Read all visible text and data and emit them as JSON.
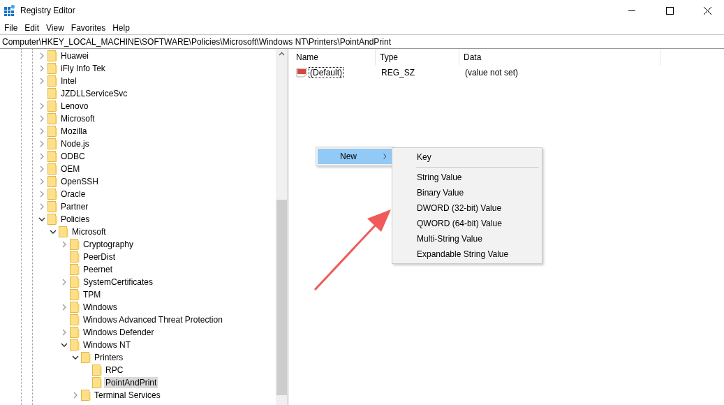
{
  "window": {
    "title": "Registry Editor"
  },
  "menu": [
    {
      "label": "File"
    },
    {
      "label": "Edit"
    },
    {
      "label": "View"
    },
    {
      "label": "Favorites"
    },
    {
      "label": "Help"
    }
  ],
  "address": "Computer\\HKEY_LOCAL_MACHINE\\SOFTWARE\\Policies\\Microsoft\\Windows NT\\Printers\\PointAndPrint",
  "tree": [
    {
      "label": "Huawei",
      "expanded": false,
      "selected": false
    },
    {
      "label": "iFly Info Tek",
      "expanded": false,
      "selected": false
    },
    {
      "label": "Intel",
      "expanded": false,
      "selected": false
    },
    {
      "label": "JZDLLServiceSvc",
      "selected": false
    },
    {
      "label": "Lenovo",
      "expanded": false,
      "selected": false
    },
    {
      "label": "Microsoft",
      "expanded": false,
      "selected": false
    },
    {
      "label": "Mozilla",
      "expanded": false,
      "selected": false
    },
    {
      "label": "Node.js",
      "expanded": false,
      "selected": false
    },
    {
      "label": "ODBC",
      "expanded": false,
      "selected": false
    },
    {
      "label": "OEM",
      "expanded": false,
      "selected": false
    },
    {
      "label": "OpenSSH",
      "expanded": false,
      "selected": false
    },
    {
      "label": "Oracle",
      "expanded": false,
      "selected": false
    },
    {
      "label": "Partner",
      "expanded": false,
      "selected": false
    },
    {
      "label": "Policies",
      "expanded": true,
      "selected": false,
      "children": [
        {
          "label": "Microsoft",
          "expanded": true,
          "selected": false,
          "children": [
            {
              "label": "Cryptography",
              "expanded": false,
              "selected": false
            },
            {
              "label": "PeerDist",
              "selected": false
            },
            {
              "label": "Peernet",
              "selected": false
            },
            {
              "label": "SystemCertificates",
              "expanded": false,
              "selected": false
            },
            {
              "label": "TPM",
              "selected": false
            },
            {
              "label": "Windows",
              "expanded": false,
              "selected": false
            },
            {
              "label": "Windows Advanced Threat Protection",
              "selected": false
            },
            {
              "label": "Windows Defender",
              "expanded": false,
              "selected": false
            },
            {
              "label": "Windows NT",
              "expanded": true,
              "selected": false,
              "children": [
                {
                  "label": "Printers",
                  "expanded": true,
                  "selected": false,
                  "children": [
                    {
                      "label": "RPC",
                      "selected": false
                    },
                    {
                      "label": "PointAndPrint",
                      "selected": true
                    }
                  ]
                },
                {
                  "label": "Terminal Services",
                  "expanded": false,
                  "selected": false
                }
              ]
            }
          ]
        }
      ]
    }
  ],
  "values": {
    "columns": [
      "Name",
      "Type",
      "Data"
    ],
    "rows": [
      {
        "name": "(Default)",
        "type": "REG_SZ",
        "data": "(value not set)",
        "focused": true
      }
    ]
  },
  "context_menu": {
    "items": [
      {
        "label": "New",
        "has_submenu": true,
        "selected": true
      }
    ]
  },
  "submenu": {
    "items": [
      {
        "kind": "item",
        "label": "Key"
      },
      {
        "kind": "separator"
      },
      {
        "kind": "item",
        "label": "String Value"
      },
      {
        "kind": "item",
        "label": "Binary Value"
      },
      {
        "kind": "item",
        "label": "DWORD (32-bit) Value"
      },
      {
        "kind": "item",
        "label": "QWORD (64-bit) Value"
      },
      {
        "kind": "item",
        "label": "Multi-String Value"
      },
      {
        "kind": "item",
        "label": "Expandable String Value"
      }
    ]
  }
}
